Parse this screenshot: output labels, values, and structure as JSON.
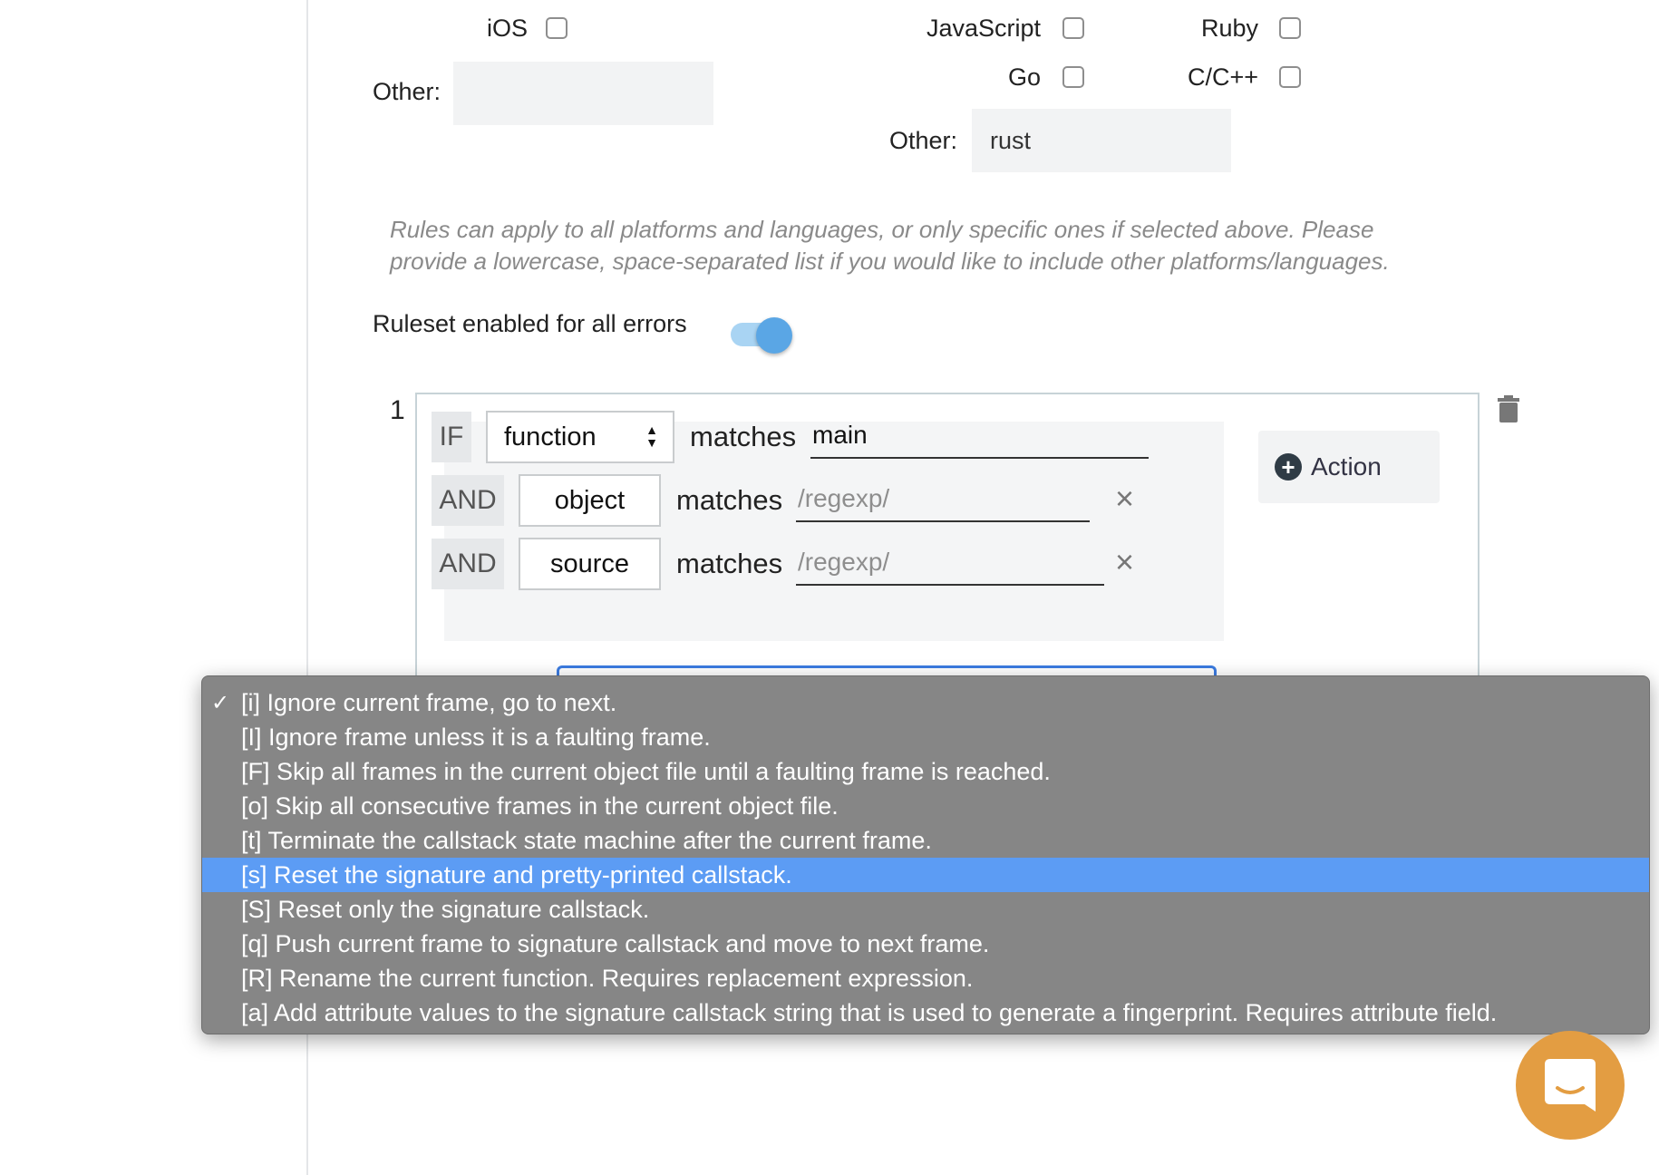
{
  "platforms": {
    "ios_label": "iOS",
    "other_label": "Other:",
    "other_value": ""
  },
  "languages": {
    "javascript_label": "JavaScript",
    "ruby_label": "Ruby",
    "go_label": "Go",
    "cpp_label": "C/C++",
    "other_label": "Other:",
    "other_value": "rust"
  },
  "hint_text": "Rules can apply to all platforms and languages, or only specific ones if selected above. Please provide a lowercase, space-separated list if you would like to include other platforms/languages.",
  "ruleset_toggle": {
    "label": "Ruleset enabled for all errors",
    "enabled": true
  },
  "rule": {
    "number": "1",
    "conditions": [
      {
        "keyword": "IF",
        "field": "function",
        "operator": "matches",
        "value": "main",
        "placeholder": ""
      },
      {
        "keyword": "AND",
        "field": "object",
        "operator": "matches",
        "value": "",
        "placeholder": "/regexp/"
      },
      {
        "keyword": "AND",
        "field": "source",
        "operator": "matches",
        "value": "",
        "placeholder": "/regexp/"
      }
    ],
    "action_button_label": "Action"
  },
  "icons": {
    "remove": "×",
    "plus": "+",
    "check": "✓",
    "select_arrows": "▲▼"
  },
  "action_dropdown": {
    "selected_index": 0,
    "highlighted_index": 5,
    "options": [
      "[i] Ignore current frame, go to next.",
      "[I] Ignore frame unless it is a faulting frame.",
      "[F] Skip all frames in the current object file until a faulting frame is reached.",
      "[o] Skip all consecutive frames in the current object file.",
      "[t] Terminate the callstack state machine after the current frame.",
      "[s] Reset the signature and pretty-printed callstack.",
      "[S] Reset only the signature callstack.",
      "[q] Push current frame to signature callstack and move to next frame.",
      "[R] Rename the current function. Requires replacement expression.",
      "[a] Add attribute values to the signature callstack string that is used to generate a fingerprint. Requires attribute field."
    ]
  },
  "colors": {
    "toggle_on": "#5aa6e5",
    "dropdown_bg": "#868686",
    "highlight": "#5c9cf4",
    "chat_button": "#e39d42"
  }
}
